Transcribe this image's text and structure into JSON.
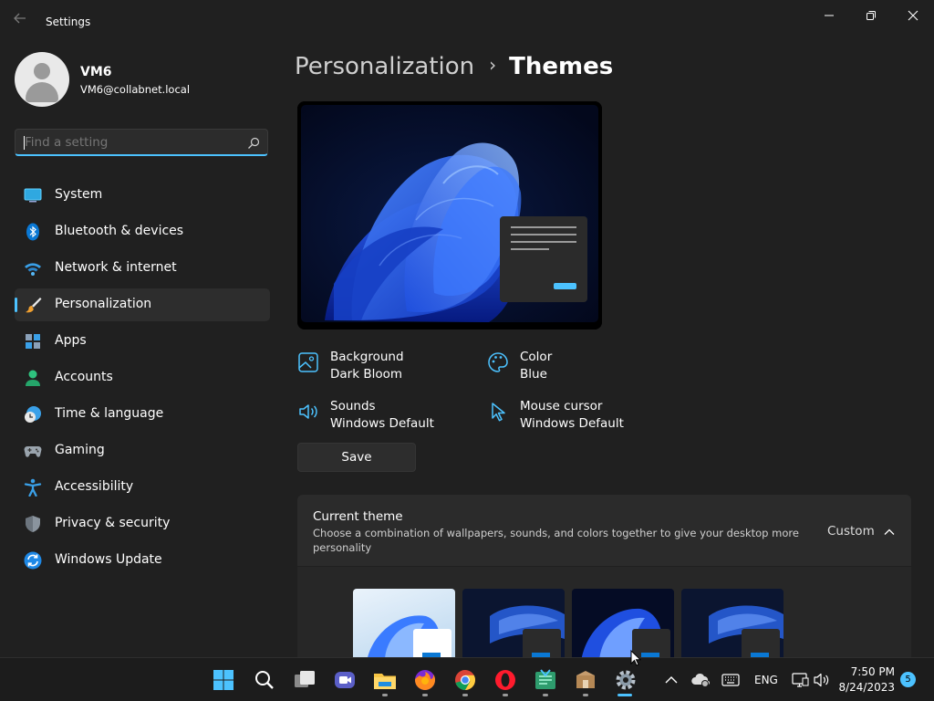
{
  "window": {
    "title": "Settings"
  },
  "profile": {
    "name": "VM6",
    "email": "VM6@collabnet.local"
  },
  "search": {
    "placeholder": "Find a setting"
  },
  "sidebar": {
    "items": [
      {
        "label": "System",
        "icon": "system-icon"
      },
      {
        "label": "Bluetooth & devices",
        "icon": "bluetooth-icon"
      },
      {
        "label": "Network & internet",
        "icon": "wifi-icon"
      },
      {
        "label": "Personalization",
        "icon": "paintbrush-icon",
        "active": true
      },
      {
        "label": "Apps",
        "icon": "apps-icon"
      },
      {
        "label": "Accounts",
        "icon": "accounts-icon"
      },
      {
        "label": "Time & language",
        "icon": "clock-globe-icon"
      },
      {
        "label": "Gaming",
        "icon": "gamepad-icon"
      },
      {
        "label": "Accessibility",
        "icon": "accessibility-icon"
      },
      {
        "label": "Privacy & security",
        "icon": "shield-icon"
      },
      {
        "label": "Windows Update",
        "icon": "update-icon"
      }
    ]
  },
  "breadcrumb": {
    "parent": "Personalization",
    "separator": "›",
    "current": "Themes"
  },
  "properties": {
    "background": {
      "label": "Background",
      "value": "Dark Bloom"
    },
    "color": {
      "label": "Color",
      "value": "Blue"
    },
    "sounds": {
      "label": "Sounds",
      "value": "Windows Default"
    },
    "cursor": {
      "label": "Mouse cursor",
      "value": "Windows Default"
    }
  },
  "save_label": "Save",
  "current_theme": {
    "title": "Current theme",
    "description": "Choose a combination of wallpapers, sounds, and colors together to give your desktop more personality",
    "value": "Custom"
  },
  "taskbar": {
    "language": "ENG",
    "time": "7:50 PM",
    "date": "8/24/2023",
    "notifications": "5"
  },
  "colors": {
    "accent": "#4cc2ff",
    "background": "#202020",
    "card": "#2b2b2b",
    "taskbar": "#1c1c1c"
  }
}
